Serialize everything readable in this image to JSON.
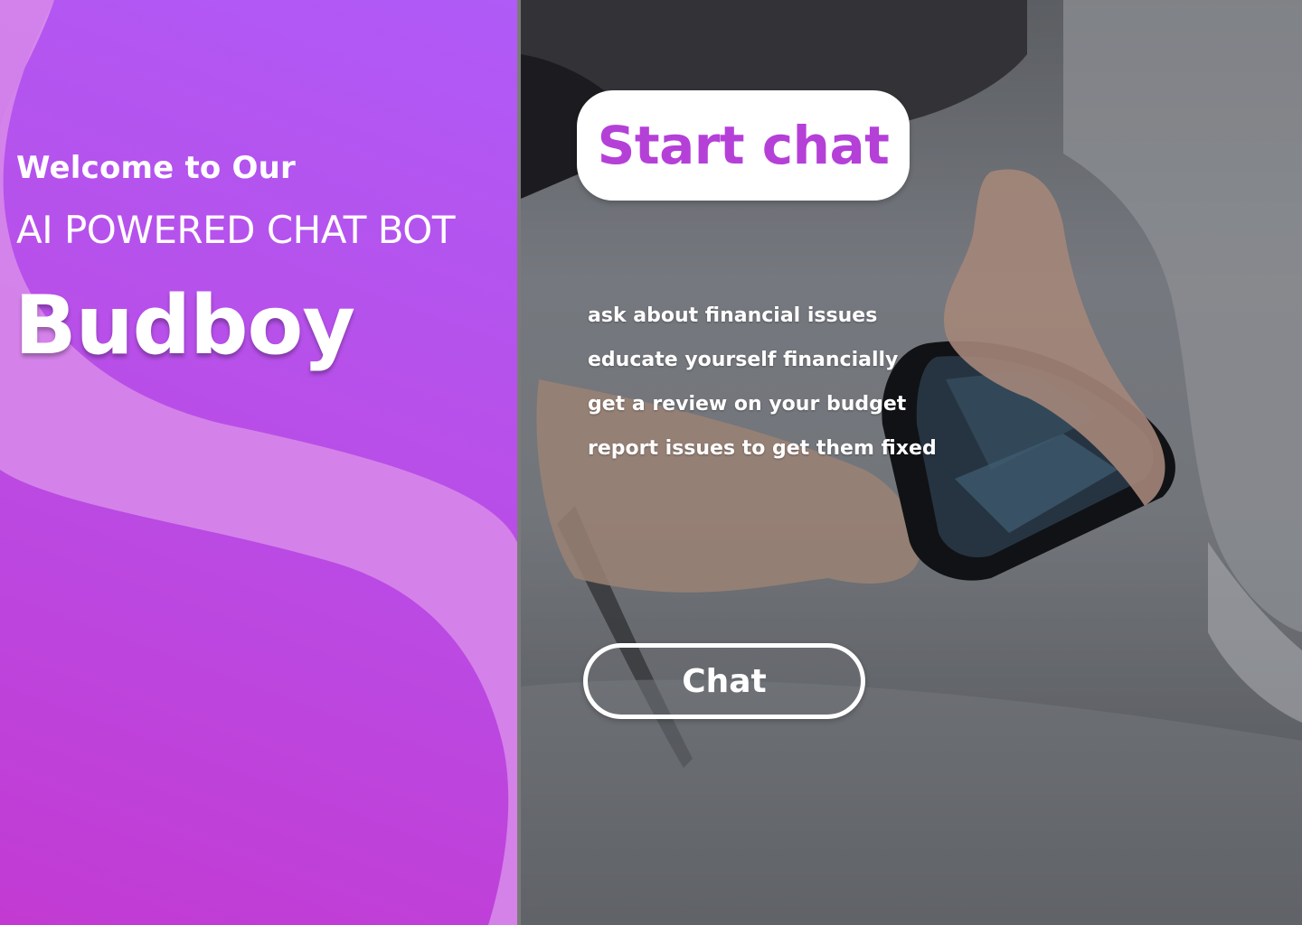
{
  "hero": {
    "welcome": "Welcome to Our",
    "subtitle": "AI POWERED CHAT BOT",
    "brand": "Budboy"
  },
  "actions": {
    "start_chat_label": "Start chat",
    "chat_label": "Chat"
  },
  "features": [
    "ask about financial issues",
    "educate yourself financially",
    "get a review on your budget",
    "report issues to get them fixed"
  ],
  "colors": {
    "accent": "#b540d8",
    "panel_top": "#b05af7",
    "panel_bottom": "#c23ad2",
    "wave": "#d886ec"
  }
}
